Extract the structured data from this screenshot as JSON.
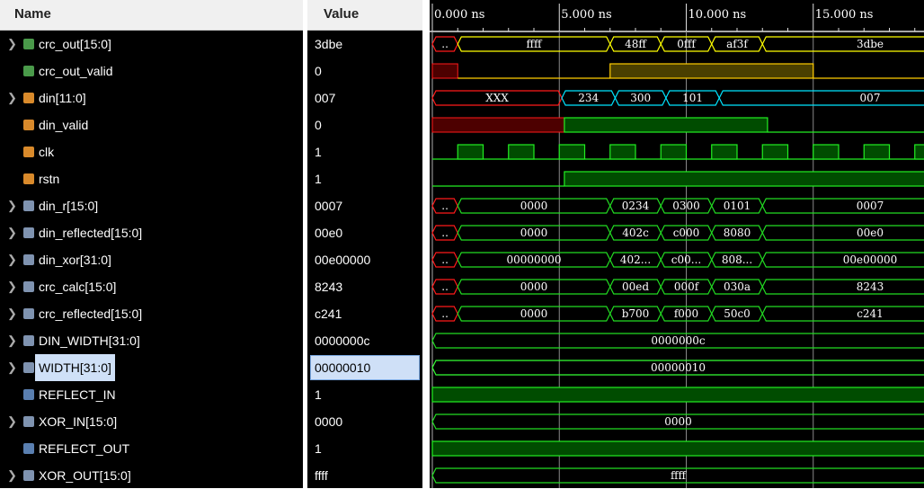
{
  "headers": {
    "name": "Name",
    "value": "Value"
  },
  "time_axis": {
    "labels": [
      "0.000 ns",
      "5.000 ns",
      "10.000 ns",
      "15.000 ns"
    ],
    "unit": "ns",
    "major_step": 5,
    "minor_step": 1,
    "range": [
      0,
      19.4
    ]
  },
  "colors": {
    "bus_yellow": "#ffff00",
    "bus_cyan": "#00e5ff",
    "bus_green": "#22dd22",
    "x_red": "#ff1a1a",
    "high_green_fill": "#004c00",
    "high_olive_fill": "#4a3f00",
    "selected": "#cfe0f7"
  },
  "signals": [
    {
      "name": "crc_out[15:0]",
      "value": "3dbe",
      "icon": "bus-output",
      "expandable": true,
      "kind": "bus",
      "color": "#ffff00",
      "segs": [
        [
          0,
          1,
          "..",
          "x"
        ],
        [
          1,
          7,
          "ffff"
        ],
        [
          7,
          9,
          "48ff"
        ],
        [
          9,
          11,
          "0fff"
        ],
        [
          11,
          13,
          "af3f"
        ],
        [
          13,
          null,
          "3dbe"
        ]
      ]
    },
    {
      "name": "crc_out_valid",
      "value": "0",
      "icon": "bit-output",
      "expandable": false,
      "kind": "bit",
      "color": "#ffcc00",
      "fill": "#4a3f00",
      "segs": [
        [
          0,
          1,
          "x"
        ],
        [
          1,
          7,
          0
        ],
        [
          7,
          15,
          1
        ],
        [
          15,
          null,
          0
        ]
      ]
    },
    {
      "name": "din[11:0]",
      "value": "007",
      "icon": "bus-input",
      "expandable": true,
      "kind": "bus",
      "color": "#00e5ff",
      "segs": [
        [
          0,
          5.1,
          "XXX",
          "x"
        ],
        [
          5.1,
          7.2,
          "234"
        ],
        [
          7.2,
          9.2,
          "300"
        ],
        [
          9.2,
          11.3,
          "101"
        ],
        [
          11.3,
          null,
          "007"
        ]
      ]
    },
    {
      "name": "din_valid",
      "value": "0",
      "icon": "bit-input",
      "expandable": false,
      "kind": "bit",
      "color": "#22ee22",
      "fill": "#004c00",
      "segs": [
        [
          0,
          5.2,
          "x"
        ],
        [
          5.2,
          13.2,
          1
        ],
        [
          13.2,
          null,
          0
        ]
      ]
    },
    {
      "name": "clk",
      "value": "1",
      "icon": "bit-input",
      "expandable": false,
      "kind": "clock",
      "color": "#22ee22",
      "fill": "#004c00",
      "period": 2,
      "first_rise": 1
    },
    {
      "name": "rstn",
      "value": "1",
      "icon": "bit-input",
      "expandable": false,
      "kind": "bit",
      "color": "#22ee22",
      "fill": "#004c00",
      "segs": [
        [
          0,
          5.2,
          0
        ],
        [
          5.2,
          null,
          1
        ]
      ]
    },
    {
      "name": "din_r[15:0]",
      "value": "0007",
      "icon": "bus-internal",
      "expandable": true,
      "kind": "bus",
      "color": "#22dd22",
      "segs": [
        [
          0,
          1,
          "..",
          "x"
        ],
        [
          1,
          7,
          "0000"
        ],
        [
          7,
          9,
          "0234"
        ],
        [
          9,
          11,
          "0300"
        ],
        [
          11,
          13,
          "0101"
        ],
        [
          13,
          null,
          "0007"
        ]
      ]
    },
    {
      "name": "din_reflected[15:0]",
      "value": "00e0",
      "icon": "bus-internal",
      "expandable": true,
      "kind": "bus",
      "color": "#22dd22",
      "segs": [
        [
          0,
          1,
          "..",
          "x"
        ],
        [
          1,
          7,
          "0000"
        ],
        [
          7,
          9,
          "402c"
        ],
        [
          9,
          11,
          "c000"
        ],
        [
          11,
          13,
          "8080"
        ],
        [
          13,
          null,
          "00e0"
        ]
      ]
    },
    {
      "name": "din_xor[31:0]",
      "value": "00e00000",
      "icon": "bus-internal",
      "expandable": true,
      "kind": "bus",
      "color": "#22dd22",
      "segs": [
        [
          0,
          1,
          "..",
          "x"
        ],
        [
          1,
          7,
          "00000000"
        ],
        [
          7,
          9,
          "402..."
        ],
        [
          9,
          11,
          "c00..."
        ],
        [
          11,
          13,
          "808..."
        ],
        [
          13,
          null,
          "00e00000"
        ]
      ]
    },
    {
      "name": "crc_calc[15:0]",
      "value": "8243",
      "icon": "bus-internal",
      "expandable": true,
      "kind": "bus",
      "color": "#22dd22",
      "segs": [
        [
          0,
          1,
          "..",
          "x"
        ],
        [
          1,
          7,
          "0000"
        ],
        [
          7,
          9,
          "00ed"
        ],
        [
          9,
          11,
          "000f"
        ],
        [
          11,
          13,
          "030a"
        ],
        [
          13,
          null,
          "8243"
        ]
      ]
    },
    {
      "name": "crc_reflected[15:0]",
      "value": "c241",
      "icon": "bus-internal",
      "expandable": true,
      "kind": "bus",
      "color": "#22dd22",
      "segs": [
        [
          0,
          1,
          "..",
          "x"
        ],
        [
          1,
          7,
          "0000"
        ],
        [
          7,
          9,
          "b700"
        ],
        [
          9,
          11,
          "f000"
        ],
        [
          11,
          13,
          "50c0"
        ],
        [
          13,
          null,
          "c241"
        ]
      ]
    },
    {
      "name": "DIN_WIDTH[31:0]",
      "value": "0000000c",
      "icon": "bus-constant",
      "expandable": true,
      "kind": "bus",
      "color": "#22dd22",
      "segs": [
        [
          0,
          null,
          "0000000c"
        ]
      ]
    },
    {
      "name": "WIDTH[31:0]",
      "value": "00000010",
      "icon": "bus-constant",
      "expandable": true,
      "selected": true,
      "kind": "bus",
      "color": "#33ff33",
      "segs": [
        [
          0,
          null,
          "00000010"
        ]
      ]
    },
    {
      "name": "REFLECT_IN",
      "value": "1",
      "icon": "bit-constant",
      "expandable": false,
      "kind": "bit",
      "color": "#22ee22",
      "fill": "#004c00",
      "segs": [
        [
          0,
          null,
          1
        ]
      ]
    },
    {
      "name": "XOR_IN[15:0]",
      "value": "0000",
      "icon": "bus-constant",
      "expandable": true,
      "kind": "bus",
      "color": "#22dd22",
      "segs": [
        [
          0,
          null,
          "0000"
        ]
      ]
    },
    {
      "name": "REFLECT_OUT",
      "value": "1",
      "icon": "bit-constant",
      "expandable": false,
      "kind": "bit",
      "color": "#22ee22",
      "fill": "#004c00",
      "segs": [
        [
          0,
          null,
          1
        ]
      ]
    },
    {
      "name": "XOR_OUT[15:0]",
      "value": "ffff",
      "icon": "bus-constant",
      "expandable": true,
      "kind": "bus",
      "color": "#22dd22",
      "segs": [
        [
          0,
          null,
          "ffff"
        ]
      ]
    }
  ]
}
